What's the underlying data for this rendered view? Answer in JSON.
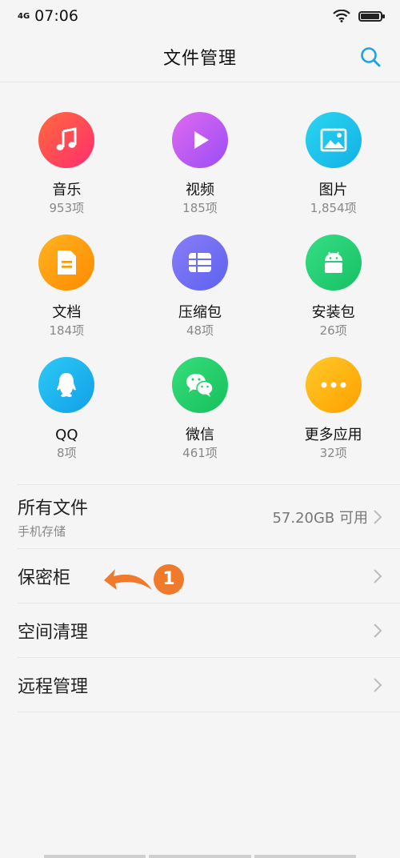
{
  "status": {
    "network": "4G",
    "time": "07:06"
  },
  "header": {
    "title": "文件管理"
  },
  "categories": [
    {
      "name": "音乐",
      "count": "953项",
      "icon": "music-icon",
      "color": "#ff3b5c"
    },
    {
      "name": "视频",
      "count": "185项",
      "icon": "play-icon",
      "color": "#b45cf2"
    },
    {
      "name": "图片",
      "count": "1,854项",
      "icon": "image-icon",
      "color": "#1ec8e8"
    },
    {
      "name": "文档",
      "count": "184项",
      "icon": "document-icon",
      "color": "#ff9800"
    },
    {
      "name": "压缩包",
      "count": "48项",
      "icon": "archive-icon",
      "color": "#6a6ff5"
    },
    {
      "name": "安装包",
      "count": "26项",
      "icon": "android-icon",
      "color": "#1fcf70"
    },
    {
      "name": "QQ",
      "count": "8项",
      "icon": "qq-icon",
      "color": "#1fb6ef"
    },
    {
      "name": "微信",
      "count": "461项",
      "icon": "wechat-icon",
      "color": "#1ece6a"
    },
    {
      "name": "更多应用",
      "count": "32项",
      "icon": "more-icon",
      "color": "#ffb300"
    }
  ],
  "list": {
    "all_files": {
      "title": "所有文件",
      "subtitle": "手机存储",
      "storage": "57.20GB 可用"
    },
    "vault": {
      "title": "保密柜"
    },
    "cleanup": {
      "title": "空间清理"
    },
    "remote": {
      "title": "远程管理"
    }
  },
  "annotation": {
    "number": "1",
    "color": "#f07a2b"
  }
}
